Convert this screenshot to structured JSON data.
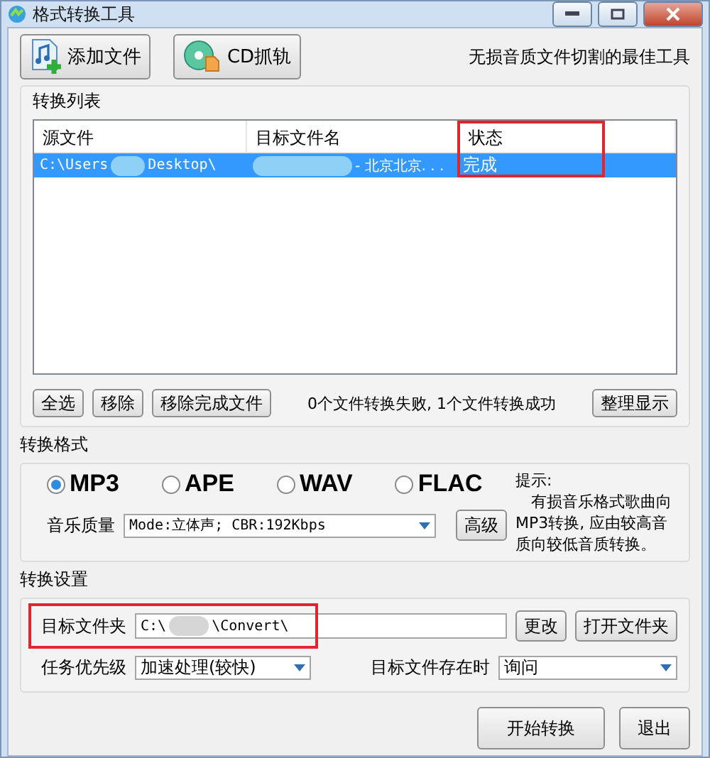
{
  "window": {
    "title": "格式转换工具"
  },
  "toolbar": {
    "buttons": [
      {
        "label": "添加文件",
        "kind": "add"
      },
      {
        "label": "CD抓轨",
        "kind": "cd"
      }
    ],
    "slogan": "无损音质文件切割的最佳工具"
  },
  "list": {
    "title": "转换列表",
    "columns": [
      "源文件",
      "目标文件名",
      "状态"
    ],
    "rows": [
      {
        "source": [
          "C:\\Users",
          "Desktop\\"
        ],
        "target": "- 北京北京. . .",
        "status": "完成",
        "selected": true
      }
    ],
    "buttons": [
      "全选",
      "移除",
      "移除完成文件"
    ],
    "summary": "0个文件转换失败, 1个文件转换成功",
    "arrange_button": "整理显示"
  },
  "format": {
    "title": "转换格式",
    "options": [
      {
        "label": "MP3",
        "selected": true
      },
      {
        "label": "APE",
        "selected": false
      },
      {
        "label": "WAV",
        "selected": false
      },
      {
        "label": "FLAC",
        "selected": false
      }
    ],
    "quality_label": "音乐质量",
    "quality_value": "Mode:立体声; CBR:192Kbps",
    "advanced_button": "高级",
    "tip_title": "提示:",
    "tip_text": "有损音乐格式歌曲向MP3转换, 应由较高音质向较低音质转换。"
  },
  "settings": {
    "title": "转换设置",
    "folder_label": "目标文件夹",
    "folder_value": [
      "C:\\",
      "\\Convert\\"
    ],
    "change_button": "更改",
    "open_button": "打开文件夹",
    "priority_label": "任务优先级",
    "priority_value": "加速处理(较快)",
    "exists_label": "目标文件存在时",
    "exists_value": "询问"
  },
  "actions": [
    "开始转换",
    "退出"
  ]
}
